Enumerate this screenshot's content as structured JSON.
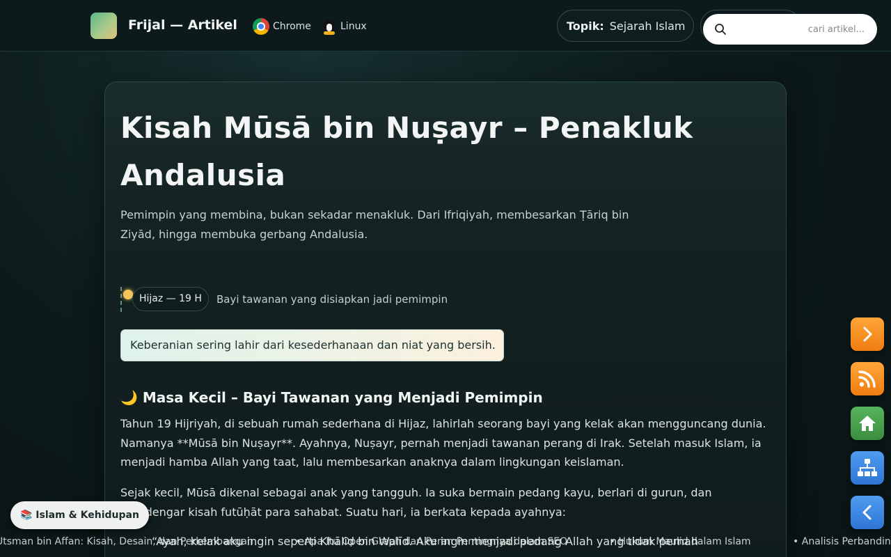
{
  "header": {
    "brand": "Frijal — Artikel",
    "browser_label": "Chrome",
    "os_label": "Linux",
    "topic_key": "Topik:",
    "topic_value": "Sejarah Islam",
    "search_placeholder": "cari artikel..."
  },
  "article": {
    "title": "Kisah Mūsā bin Nuṣayr – Penakluk Andalusia",
    "subtitle": "Pemimpin yang membina, bukan sekadar menakluk. Dari Ifriqiyah, membesarkan Ṭāriq bin Ziyād, hingga membuka gerbang Andalusia.",
    "timeline": {
      "era": "Hijaz — 19 H",
      "description": "Bayi tawanan yang disiapkan jadi pemimpin"
    },
    "quote": "Keberanian sering lahir dari kesederhanaan dan niat yang bersih.",
    "section_heading": "🌙 Masa Kecil – Bayi Tawanan yang Menjadi Pemimpin",
    "paragraphs": [
      "Tahun 19 Hijriyah, di sebuah rumah sederhana di Hijaz, lahirlah seorang bayi yang kelak akan mengguncang dunia. Namanya **Mūsā bin Nuṣayr**. Ayahnya, Nuṣayr, pernah menjadi tawanan perang di Irak. Setelah masuk Islam, ia menjadi hamba Allah yang taat, lalu membesarkan anaknya dalam lingkungan keislaman.",
      "Sejak kecil, Mūsā dikenal sebagai anak yang tangguh. Ia suka bermain pedang kayu, berlari di gurun, dan mendengar kisah futūḥāt para sahabat. Suatu hari, ia berkata kepada ayahnya:"
    ],
    "dialog": "“Ayah, kelak aku ingin seperti Khālid bin Walīd. Aku ingin menjadi pedang Allah yang tidak pernah"
  },
  "ticker_items": [
    "Utsman bin Affan: Kisah, Desain, dan Perkembangan",
    "• Apa Itu Open Graph dan Peran Pentingnya dalam SEO",
    "• Hukum Maulid dalam Islam",
    "• Analisis Perbandingan: Hukum Perayaan Maulid"
  ],
  "category_chip": "📚 Islam & Kehidupan",
  "fab_icons": [
    "chevron-right-icon",
    "rss-icon",
    "home-icon",
    "sitemap-icon",
    "chevron-left-icon"
  ],
  "colors": {
    "fab_orange": "#f28a1f",
    "fab_green": "#43a047",
    "fab_blue": "#3b87e0",
    "timeline_dot": "#f3c45c"
  }
}
